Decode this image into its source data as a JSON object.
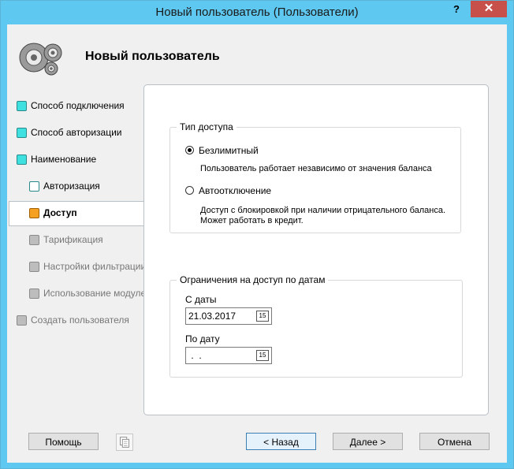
{
  "window": {
    "title": "Новый пользователь (Пользователи)",
    "help": "?",
    "close": "✕"
  },
  "header": {
    "title": "Новый пользователь",
    "icon": "gears-icon"
  },
  "steps": [
    {
      "label": "Способ подключения",
      "state": "done"
    },
    {
      "label": "Способ авторизации",
      "state": "done"
    },
    {
      "label": "Наименование",
      "state": "done"
    },
    {
      "label": "Авторизация",
      "state": "sub"
    },
    {
      "label": "Доступ",
      "state": "active"
    },
    {
      "label": "Тарификация",
      "state": "disabled"
    },
    {
      "label": "Настройки фильтрации",
      "state": "disabled"
    },
    {
      "label": "Использование модулей",
      "state": "disabled"
    },
    {
      "label": "Создать пользователя",
      "state": "disabled"
    }
  ],
  "access_type": {
    "legend": "Тип доступа",
    "unlimited": {
      "label": "Безлимитный",
      "selected": true,
      "desc": "Пользователь работает независимо от значения баланса"
    },
    "auto_off": {
      "label": "Автоотключение",
      "selected": false,
      "desc_line1": "Доступ с блокировкой при наличии отрицательного баланса.",
      "desc_line2": "Может работать в кредит."
    }
  },
  "date_limits": {
    "legend": "Ограничения на доступ по датам",
    "from_label": "С даты",
    "from_value": "21.03.2017",
    "to_label": "По дату",
    "to_value": " .  .",
    "cal_glyph": "15"
  },
  "buttons": {
    "help": "Помощь",
    "back": "< Назад",
    "next": "Далее >",
    "cancel": "Отмена"
  }
}
